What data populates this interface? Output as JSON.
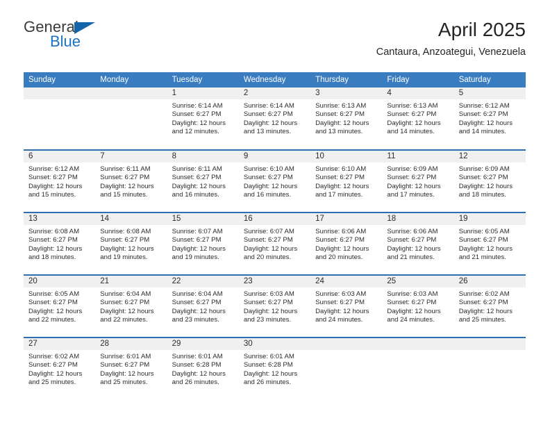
{
  "brand": {
    "name_part1": "General",
    "name_part2": "Blue",
    "triangle_color": "#1464aa",
    "blue_color": "#1a72c0"
  },
  "header": {
    "title": "April 2025",
    "subtitle": "Cantaura, Anzoategui, Venezuela"
  },
  "theme": {
    "header_bg": "#3a7cc0",
    "row_divider": "#2e6fb0",
    "daynum_bg": "#f0f0f0",
    "text": "#2b2b2b"
  },
  "calendar": {
    "weekday_headers": [
      "Sunday",
      "Monday",
      "Tuesday",
      "Wednesday",
      "Thursday",
      "Friday",
      "Saturday"
    ],
    "labels": {
      "sunrise": "Sunrise:",
      "sunset": "Sunset:",
      "daylight": "Daylight:"
    },
    "weeks": [
      [
        {
          "day": "",
          "sunrise": "",
          "sunset": "",
          "daylight_line1": "",
          "daylight_line2": ""
        },
        {
          "day": "",
          "sunrise": "",
          "sunset": "",
          "daylight_line1": "",
          "daylight_line2": ""
        },
        {
          "day": "1",
          "sunrise": "Sunrise: 6:14 AM",
          "sunset": "Sunset: 6:27 PM",
          "daylight_line1": "Daylight: 12 hours",
          "daylight_line2": "and 12 minutes."
        },
        {
          "day": "2",
          "sunrise": "Sunrise: 6:14 AM",
          "sunset": "Sunset: 6:27 PM",
          "daylight_line1": "Daylight: 12 hours",
          "daylight_line2": "and 13 minutes."
        },
        {
          "day": "3",
          "sunrise": "Sunrise: 6:13 AM",
          "sunset": "Sunset: 6:27 PM",
          "daylight_line1": "Daylight: 12 hours",
          "daylight_line2": "and 13 minutes."
        },
        {
          "day": "4",
          "sunrise": "Sunrise: 6:13 AM",
          "sunset": "Sunset: 6:27 PM",
          "daylight_line1": "Daylight: 12 hours",
          "daylight_line2": "and 14 minutes."
        },
        {
          "day": "5",
          "sunrise": "Sunrise: 6:12 AM",
          "sunset": "Sunset: 6:27 PM",
          "daylight_line1": "Daylight: 12 hours",
          "daylight_line2": "and 14 minutes."
        }
      ],
      [
        {
          "day": "6",
          "sunrise": "Sunrise: 6:12 AM",
          "sunset": "Sunset: 6:27 PM",
          "daylight_line1": "Daylight: 12 hours",
          "daylight_line2": "and 15 minutes."
        },
        {
          "day": "7",
          "sunrise": "Sunrise: 6:11 AM",
          "sunset": "Sunset: 6:27 PM",
          "daylight_line1": "Daylight: 12 hours",
          "daylight_line2": "and 15 minutes."
        },
        {
          "day": "8",
          "sunrise": "Sunrise: 6:11 AM",
          "sunset": "Sunset: 6:27 PM",
          "daylight_line1": "Daylight: 12 hours",
          "daylight_line2": "and 16 minutes."
        },
        {
          "day": "9",
          "sunrise": "Sunrise: 6:10 AM",
          "sunset": "Sunset: 6:27 PM",
          "daylight_line1": "Daylight: 12 hours",
          "daylight_line2": "and 16 minutes."
        },
        {
          "day": "10",
          "sunrise": "Sunrise: 6:10 AM",
          "sunset": "Sunset: 6:27 PM",
          "daylight_line1": "Daylight: 12 hours",
          "daylight_line2": "and 17 minutes."
        },
        {
          "day": "11",
          "sunrise": "Sunrise: 6:09 AM",
          "sunset": "Sunset: 6:27 PM",
          "daylight_line1": "Daylight: 12 hours",
          "daylight_line2": "and 17 minutes."
        },
        {
          "day": "12",
          "sunrise": "Sunrise: 6:09 AM",
          "sunset": "Sunset: 6:27 PM",
          "daylight_line1": "Daylight: 12 hours",
          "daylight_line2": "and 18 minutes."
        }
      ],
      [
        {
          "day": "13",
          "sunrise": "Sunrise: 6:08 AM",
          "sunset": "Sunset: 6:27 PM",
          "daylight_line1": "Daylight: 12 hours",
          "daylight_line2": "and 18 minutes."
        },
        {
          "day": "14",
          "sunrise": "Sunrise: 6:08 AM",
          "sunset": "Sunset: 6:27 PM",
          "daylight_line1": "Daylight: 12 hours",
          "daylight_line2": "and 19 minutes."
        },
        {
          "day": "15",
          "sunrise": "Sunrise: 6:07 AM",
          "sunset": "Sunset: 6:27 PM",
          "daylight_line1": "Daylight: 12 hours",
          "daylight_line2": "and 19 minutes."
        },
        {
          "day": "16",
          "sunrise": "Sunrise: 6:07 AM",
          "sunset": "Sunset: 6:27 PM",
          "daylight_line1": "Daylight: 12 hours",
          "daylight_line2": "and 20 minutes."
        },
        {
          "day": "17",
          "sunrise": "Sunrise: 6:06 AM",
          "sunset": "Sunset: 6:27 PM",
          "daylight_line1": "Daylight: 12 hours",
          "daylight_line2": "and 20 minutes."
        },
        {
          "day": "18",
          "sunrise": "Sunrise: 6:06 AM",
          "sunset": "Sunset: 6:27 PM",
          "daylight_line1": "Daylight: 12 hours",
          "daylight_line2": "and 21 minutes."
        },
        {
          "day": "19",
          "sunrise": "Sunrise: 6:05 AM",
          "sunset": "Sunset: 6:27 PM",
          "daylight_line1": "Daylight: 12 hours",
          "daylight_line2": "and 21 minutes."
        }
      ],
      [
        {
          "day": "20",
          "sunrise": "Sunrise: 6:05 AM",
          "sunset": "Sunset: 6:27 PM",
          "daylight_line1": "Daylight: 12 hours",
          "daylight_line2": "and 22 minutes."
        },
        {
          "day": "21",
          "sunrise": "Sunrise: 6:04 AM",
          "sunset": "Sunset: 6:27 PM",
          "daylight_line1": "Daylight: 12 hours",
          "daylight_line2": "and 22 minutes."
        },
        {
          "day": "22",
          "sunrise": "Sunrise: 6:04 AM",
          "sunset": "Sunset: 6:27 PM",
          "daylight_line1": "Daylight: 12 hours",
          "daylight_line2": "and 23 minutes."
        },
        {
          "day": "23",
          "sunrise": "Sunrise: 6:03 AM",
          "sunset": "Sunset: 6:27 PM",
          "daylight_line1": "Daylight: 12 hours",
          "daylight_line2": "and 23 minutes."
        },
        {
          "day": "24",
          "sunrise": "Sunrise: 6:03 AM",
          "sunset": "Sunset: 6:27 PM",
          "daylight_line1": "Daylight: 12 hours",
          "daylight_line2": "and 24 minutes."
        },
        {
          "day": "25",
          "sunrise": "Sunrise: 6:03 AM",
          "sunset": "Sunset: 6:27 PM",
          "daylight_line1": "Daylight: 12 hours",
          "daylight_line2": "and 24 minutes."
        },
        {
          "day": "26",
          "sunrise": "Sunrise: 6:02 AM",
          "sunset": "Sunset: 6:27 PM",
          "daylight_line1": "Daylight: 12 hours",
          "daylight_line2": "and 25 minutes."
        }
      ],
      [
        {
          "day": "27",
          "sunrise": "Sunrise: 6:02 AM",
          "sunset": "Sunset: 6:27 PM",
          "daylight_line1": "Daylight: 12 hours",
          "daylight_line2": "and 25 minutes."
        },
        {
          "day": "28",
          "sunrise": "Sunrise: 6:01 AM",
          "sunset": "Sunset: 6:27 PM",
          "daylight_line1": "Daylight: 12 hours",
          "daylight_line2": "and 25 minutes."
        },
        {
          "day": "29",
          "sunrise": "Sunrise: 6:01 AM",
          "sunset": "Sunset: 6:28 PM",
          "daylight_line1": "Daylight: 12 hours",
          "daylight_line2": "and 26 minutes."
        },
        {
          "day": "30",
          "sunrise": "Sunrise: 6:01 AM",
          "sunset": "Sunset: 6:28 PM",
          "daylight_line1": "Daylight: 12 hours",
          "daylight_line2": "and 26 minutes."
        },
        {
          "day": "",
          "sunrise": "",
          "sunset": "",
          "daylight_line1": "",
          "daylight_line2": ""
        },
        {
          "day": "",
          "sunrise": "",
          "sunset": "",
          "daylight_line1": "",
          "daylight_line2": ""
        },
        {
          "day": "",
          "sunrise": "",
          "sunset": "",
          "daylight_line1": "",
          "daylight_line2": ""
        }
      ]
    ]
  }
}
